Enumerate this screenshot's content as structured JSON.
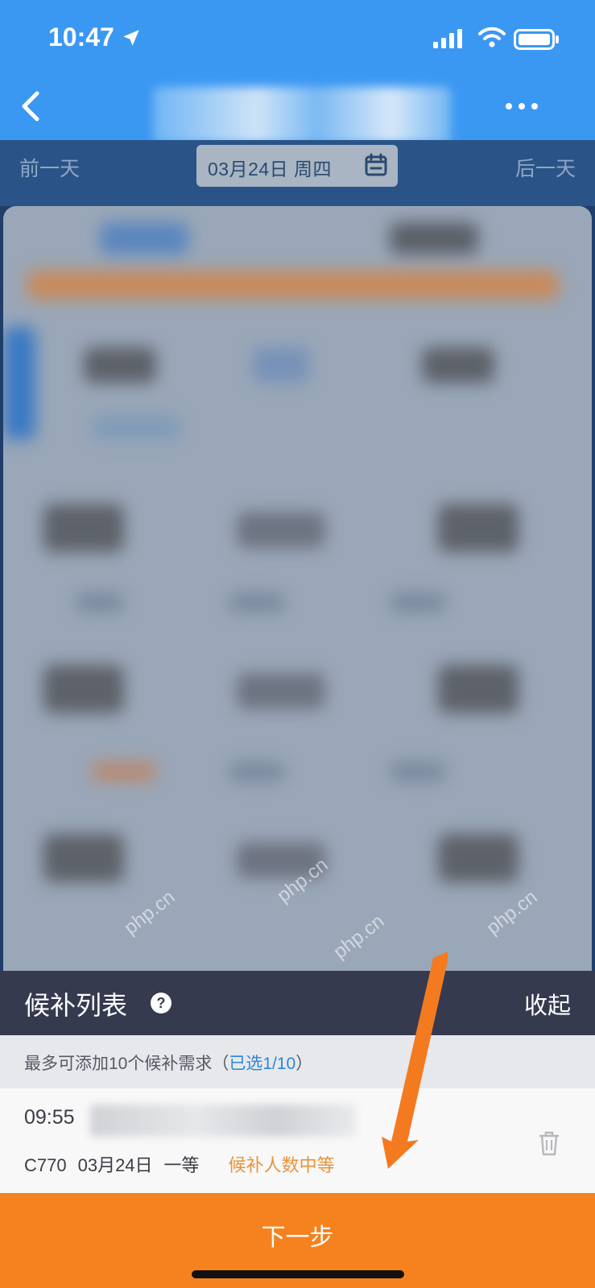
{
  "status_bar": {
    "time": "10:47"
  },
  "date_bar": {
    "prev_day": "前一天",
    "date": "03月24日 周四",
    "next_day": "后一天"
  },
  "queue": {
    "title": "候补列表",
    "collapse": "收起",
    "limit_text": "最多可添加10个候补需求（",
    "limit_selected": "已选1/10",
    "limit_close": "）"
  },
  "item": {
    "time": "09:55",
    "train": "C770",
    "date": "03月24日",
    "seat": "一等",
    "status": "候补人数中等"
  },
  "footer": {
    "next_button": "下一步"
  },
  "watermark": "php.cn",
  "colors": {
    "primary_blue": "#3b98f2",
    "date_bar": "#2a5487",
    "queue_header": "#353a4f",
    "accent_orange": "#f5821f",
    "status_orange": "#e8923c",
    "link_blue": "#2c86d8"
  },
  "icons": [
    "back-icon",
    "more-icon",
    "calendar-icon",
    "help-icon",
    "trash-icon",
    "location-icon",
    "signal-icon",
    "wifi-icon",
    "battery-icon"
  ]
}
